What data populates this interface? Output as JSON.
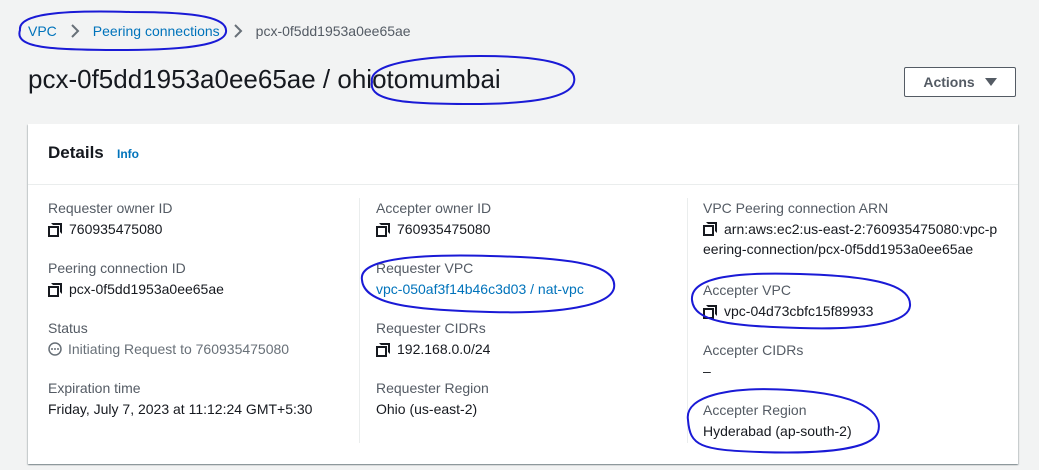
{
  "breadcrumb": {
    "items": [
      "VPC",
      "Peering connections"
    ],
    "current": "pcx-0f5dd1953a0ee65ae"
  },
  "page": {
    "title": "pcx-0f5dd1953a0ee65ae / ohiotomumbai"
  },
  "actions": {
    "label": "Actions"
  },
  "details": {
    "title": "Details",
    "info_label": "Info",
    "requester_owner_id": {
      "label": "Requester owner ID",
      "value": "760935475080"
    },
    "peering_connection_id": {
      "label": "Peering connection ID",
      "value": "pcx-0f5dd1953a0ee65ae"
    },
    "status": {
      "label": "Status",
      "value": "Initiating Request to 760935475080"
    },
    "expiration_time": {
      "label": "Expiration time",
      "value": "Friday, July 7, 2023 at 11:12:24 GMT+5:30"
    },
    "accepter_owner_id": {
      "label": "Accepter owner ID",
      "value": "760935475080"
    },
    "requester_vpc": {
      "label": "Requester VPC",
      "value": "vpc-050af3f14b46c3d03 / nat-vpc"
    },
    "requester_cidrs": {
      "label": "Requester CIDRs",
      "value": "192.168.0.0/24"
    },
    "requester_region": {
      "label": "Requester Region",
      "value": "Ohio (us-east-2)"
    },
    "peering_arn": {
      "label": "VPC Peering connection ARN",
      "value": "arn:aws:ec2:us-east-2:760935475080:vpc-peering-connection/pcx-0f5dd1953a0ee65ae"
    },
    "accepter_vpc": {
      "label": "Accepter VPC",
      "value": "vpc-04d73cbfc15f89933"
    },
    "accepter_cidrs": {
      "label": "Accepter CIDRs",
      "value": "–"
    },
    "accepter_region": {
      "label": "Accepter Region",
      "value": "Hyderabad (ap-south-2)"
    }
  },
  "colors": {
    "link": "#0073bb",
    "text": "#16191f",
    "label": "#545b64",
    "annotation": "#1a1ad6"
  }
}
